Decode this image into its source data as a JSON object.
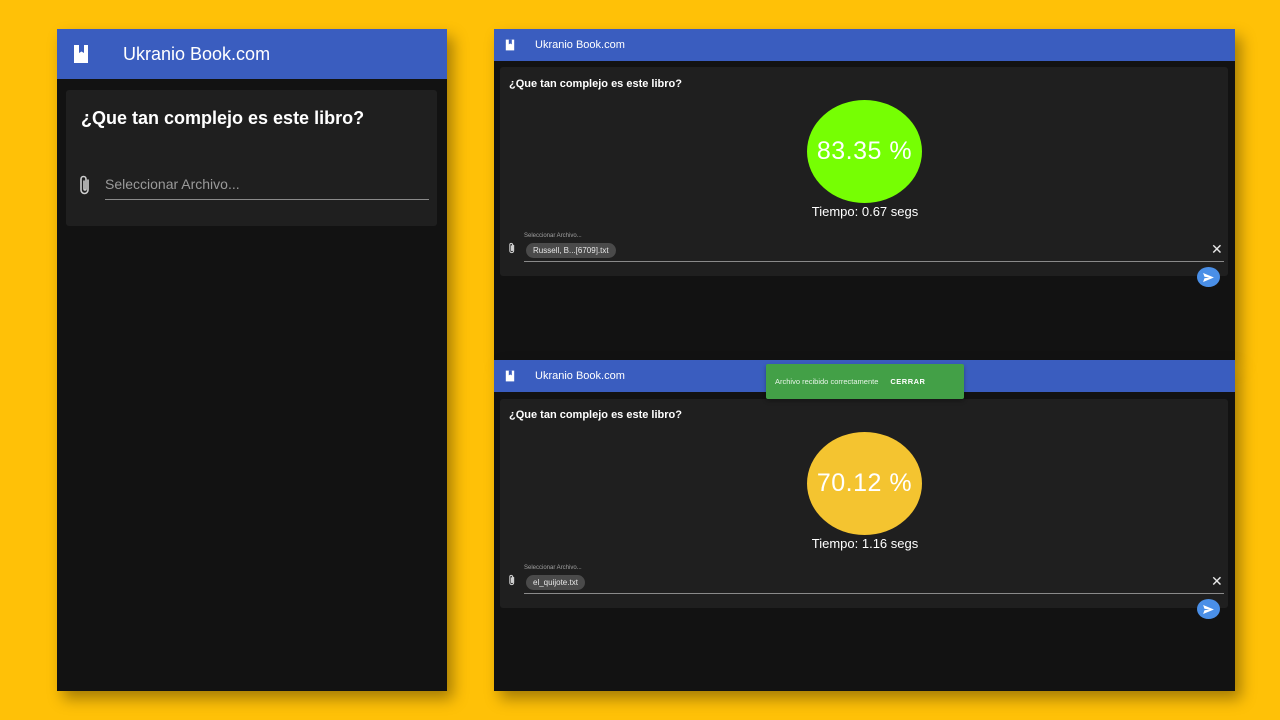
{
  "app": {
    "brand": "Ukranio Book.com",
    "question": "¿Que tan complejo es este libro?"
  },
  "left_panel": {
    "file_placeholder": "Seleccionar Archivo..."
  },
  "result_top": {
    "file_label": "Seleccionar Archivo...",
    "file_chip": "Russell, B...[6709].txt",
    "score": "83.35 %",
    "score_value": 83.35,
    "time": "Tiempo: 0.67 segs",
    "circle_color": "#76FF03"
  },
  "result_bottom": {
    "file_label": "Seleccionar Archivo...",
    "file_chip": "el_quijote.txt",
    "score": "70.12 %",
    "score_value": 70.12,
    "time": "Tiempo: 1.16 segs",
    "circle_color": "#F4C430"
  },
  "snackbar": {
    "message": "Archivo recibido correctamente",
    "action": "CERRAR"
  },
  "colors": {
    "background": "#FFC107",
    "appbar": "#3A5DBF",
    "surface": "#121212",
    "card": "#1F1F1F",
    "snackbar": "#43A047",
    "send_button": "#4A8FE7"
  },
  "icons": [
    "book-icon",
    "paperclip-icon",
    "close-icon",
    "send-icon"
  ]
}
